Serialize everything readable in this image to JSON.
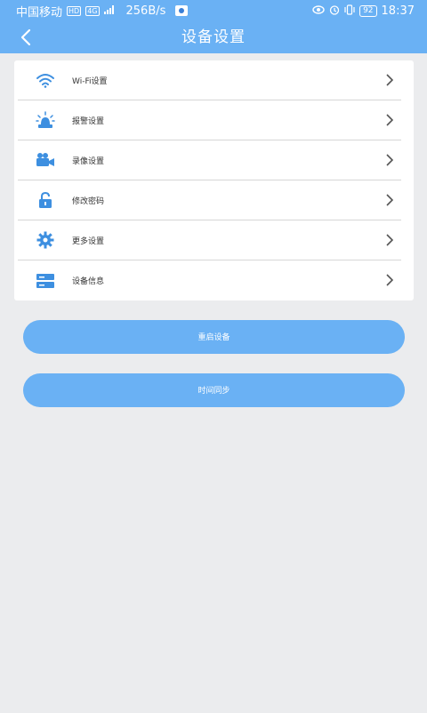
{
  "statusbar": {
    "carrier": "中国移动",
    "hd_badge": "HD",
    "net_badge": "4G",
    "speed": "256B/s",
    "battery": "92",
    "time": "18:37"
  },
  "header": {
    "title": "设备设置"
  },
  "menu": {
    "items": [
      {
        "label": "Wi-Fi设置",
        "icon": "wifi-icon"
      },
      {
        "label": "报警设置",
        "icon": "alarm-light-icon"
      },
      {
        "label": "录像设置",
        "icon": "video-camera-icon"
      },
      {
        "label": "修改密码",
        "icon": "lock-icon"
      },
      {
        "label": "更多设置",
        "icon": "gear-icon"
      },
      {
        "label": "设备信息",
        "icon": "server-icon"
      }
    ]
  },
  "buttons": {
    "restart": "重启设备",
    "time_sync": "时间同步"
  },
  "colors": {
    "primary": "#6ab1f4",
    "icon": "#3d8fe0",
    "background": "#ebecee"
  }
}
